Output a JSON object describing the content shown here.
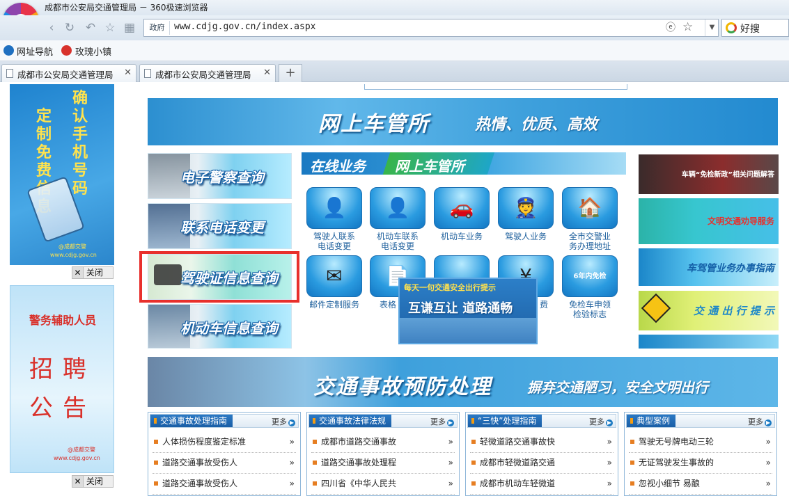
{
  "browser": {
    "title": "成都市公安局交通管理局 － 360极速浏览器",
    "address_tag": "政府",
    "url": "www.cdjg.gov.cn/index.aspx",
    "search_label": "好搜",
    "bookmarks": [
      "网址导航",
      "玫瑰小镇"
    ],
    "tabs": [
      "成都市公安局交通管理局",
      "成都市公安局交通管理局"
    ],
    "new_tab": "+"
  },
  "left_ads": {
    "ad1": {
      "line_a": "确认手机号码",
      "line_b": "定制免费信息",
      "sub1": "@成都交警",
      "sub2": "www.cdjg.gov.cn",
      "close": "关闭"
    },
    "ad2": {
      "top": "警务辅助人员",
      "big1": "招聘",
      "big2": "公告",
      "sub1": "@成都交警",
      "sub2": "www.cdjg.gov.cn",
      "close": "关闭"
    }
  },
  "banner_top": {
    "title": "网上车管所",
    "slogan": "热情、优质、高效"
  },
  "left_buttons": [
    "电子警察查询",
    "联系电话变更",
    "驾驶证信息查询",
    "机动车信息查询"
  ],
  "online": {
    "head_a": "在线业务",
    "head_b": "网上车管所",
    "services": [
      {
        "label": "驾驶人联系电话变更",
        "icon": "👤"
      },
      {
        "label": "机动车联系电话变更",
        "icon": "👤"
      },
      {
        "label": "机动车业务",
        "icon": "🚗"
      },
      {
        "label": "驾驶人业务",
        "icon": "👮"
      },
      {
        "label": "全市交警业务办理地址",
        "icon": "🏠"
      },
      {
        "label": "邮件定制服务",
        "icon": "✉"
      },
      {
        "label": "表格",
        "icon": "📄"
      },
      {
        "label": "",
        "icon": ""
      },
      {
        "label": "费",
        "icon": "¥"
      },
      {
        "label": "免检车申领检验标志",
        "icon": "6年内免检"
      }
    ],
    "popup": {
      "top": "每天一句交通安全出行提示",
      "main": "互谦互让  道路通畅"
    }
  },
  "right_buttons": [
    "车辆“免检新政”相关问题解答",
    "文明交通劝导服务",
    "车驾管业务办事指南",
    "交 通 出 行 提 示"
  ],
  "banner_mid": {
    "title": "交通事故预防处理",
    "slogan": "摒弃交通陋习，安全文明出行"
  },
  "panels": [
    {
      "title": "交通事故处理指南",
      "more": "更多",
      "items": [
        "人体损伤程度鉴定标准",
        "道路交通事故受伤人",
        "道路交通事故受伤人"
      ]
    },
    {
      "title": "交通事故法律法规",
      "more": "更多",
      "items": [
        "成都市道路交通事故",
        "道路交通事故处理程",
        "四川省《中华人民共"
      ]
    },
    {
      "title": "“三快”处理指南",
      "more": "更多",
      "items": [
        "轻微道路交通事故快",
        "成都市轻微道路交通",
        "成都市机动车轻微道"
      ]
    },
    {
      "title": "典型案例",
      "more": "更多",
      "items": [
        "驾驶无号牌电动三轮",
        "无证驾驶发生事故的",
        "忽视小细节 易酿"
      ]
    }
  ],
  "arrow": "»",
  "colors": {
    "highlight": "#e8302c",
    "brand_blue": "#1a79c2"
  }
}
